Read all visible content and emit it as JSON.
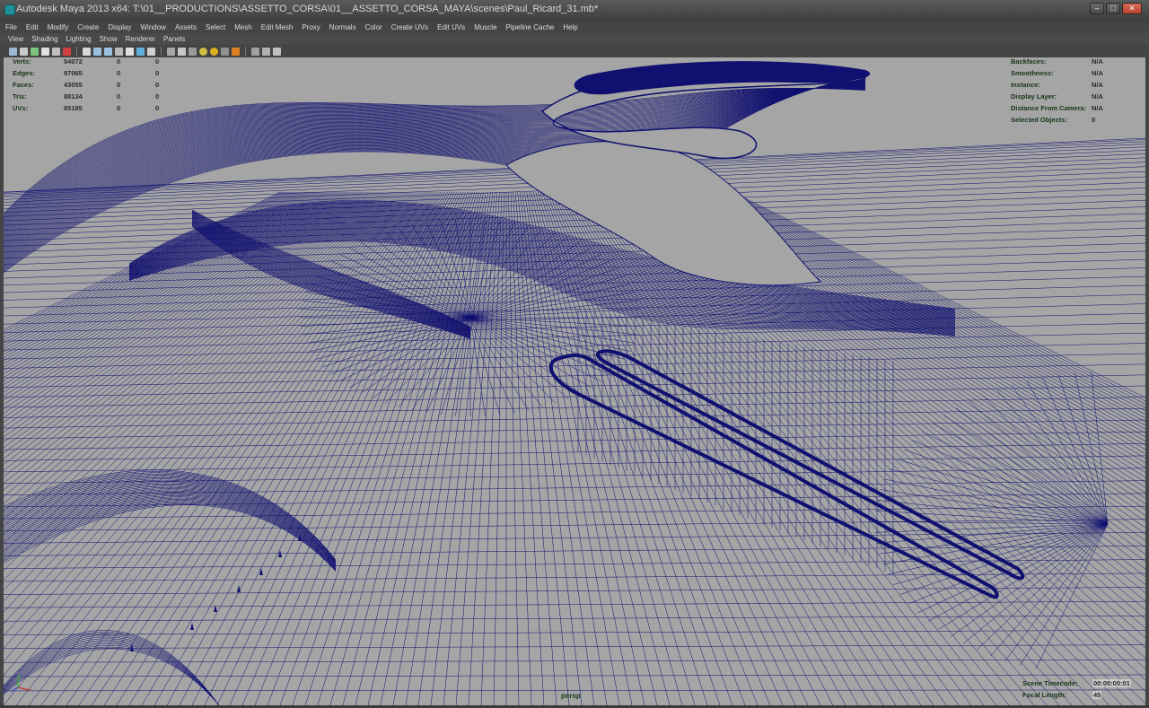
{
  "window": {
    "title": "Autodesk Maya 2013 x64: T:\\01__PRODUCTIONS\\ASSETTO_CORSA\\01__ASSETTO_CORSA_MAYA\\scenes\\Paul_Ricard_31.mb*",
    "buttons": {
      "minimize": "–",
      "maximize": "□",
      "close": "✕"
    }
  },
  "main_menu": [
    "File",
    "Edit",
    "Modify",
    "Create",
    "Display",
    "Window",
    "Assets",
    "Select",
    "Mesh",
    "Edit Mesh",
    "Proxy",
    "Normals",
    "Color",
    "Create UVs",
    "Edit UVs",
    "Muscle",
    "Pipeline Cache",
    "Help"
  ],
  "panel_menu": [
    "View",
    "Shading",
    "Lighting",
    "Show",
    "Renderer",
    "Panels"
  ],
  "toolbar_icons": [
    "camera-select-icon",
    "camera-attr-icon",
    "bookmark-icon",
    "image-plane-icon",
    "2d-pan-icon",
    "grease-pencil-icon",
    "grid-icon",
    "film-gate-icon",
    "resolution-gate-icon",
    "gate-mask-icon",
    "field-chart-icon",
    "safe-action-icon",
    "safe-title-icon",
    "wireframe-icon",
    "smooth-shade-icon",
    "wireframe-on-shaded-icon",
    "textured-icon",
    "use-lights-icon",
    "shadows-icon",
    "isolate-select-icon",
    "xray-icon",
    "xray-joints-icon",
    "xray-components-icon"
  ],
  "hud_left": {
    "rows": [
      {
        "label": "Verts:",
        "values": [
          "54072",
          "0",
          "0"
        ]
      },
      {
        "label": "Edges:",
        "values": [
          "97065",
          "0",
          "0"
        ]
      },
      {
        "label": "Faces:",
        "values": [
          "43055",
          "0",
          "0"
        ]
      },
      {
        "label": "Tris:",
        "values": [
          "88134",
          "0",
          "0"
        ]
      },
      {
        "label": "UVs:",
        "values": [
          "65185",
          "0",
          "0"
        ]
      }
    ]
  },
  "hud_right": {
    "rows": [
      {
        "label": "Backfaces:",
        "value": "N/A"
      },
      {
        "label": "Smoothness:",
        "value": "N/A"
      },
      {
        "label": "Instance:",
        "value": "N/A"
      },
      {
        "label": "Display Layer:",
        "value": "N/A"
      },
      {
        "label": "Distance From Camera:",
        "value": "N/A"
      },
      {
        "label": "Selected Objects:",
        "value": "0"
      }
    ]
  },
  "hud_bottom_right": {
    "scene_timecode_label": "Scene Timecode:",
    "scene_timecode": "00:00:00:01",
    "focal_length_label": "Focal Length:",
    "focal_length": "45"
  },
  "camera_name": "persp",
  "colors": {
    "viewport_bg": "#a5a5a5",
    "wire": "#101070",
    "hud_label": "#173417"
  }
}
